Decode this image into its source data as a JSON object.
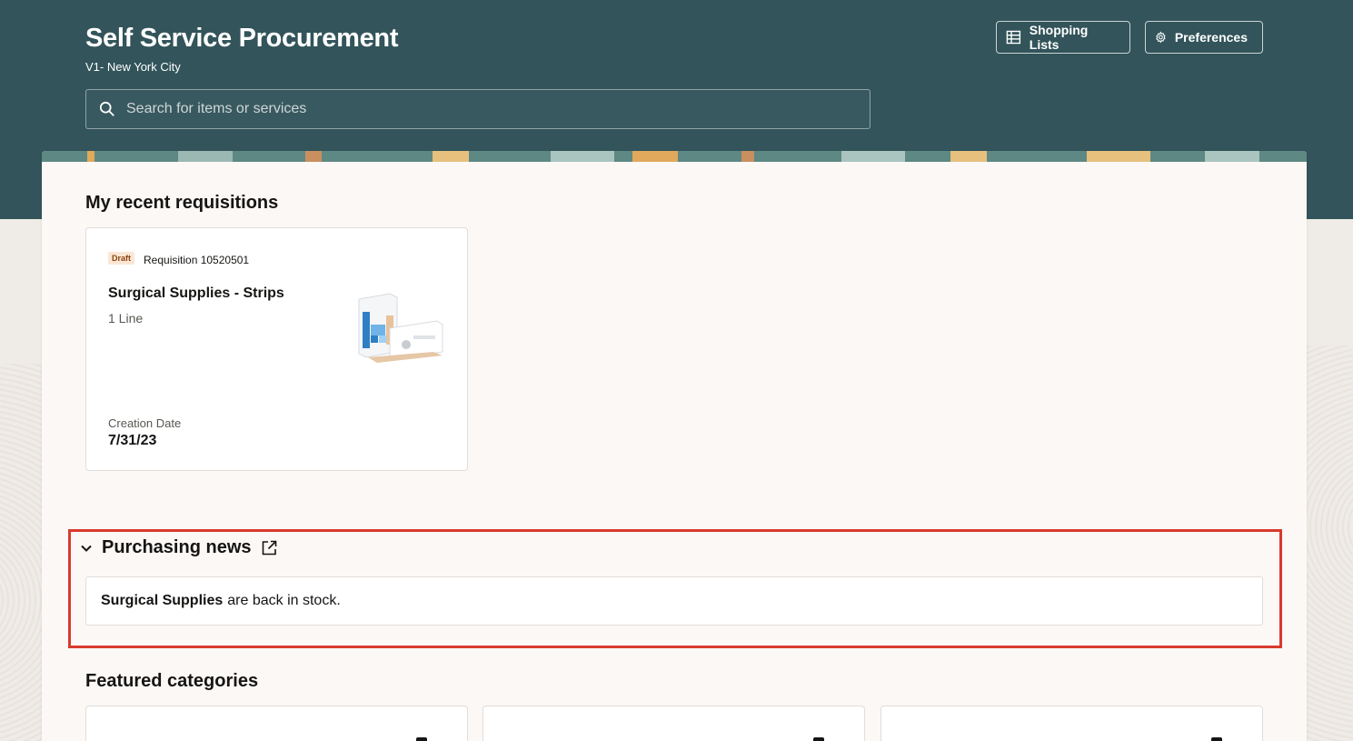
{
  "header": {
    "title": "Self Service Procurement",
    "location": "V1- New York City",
    "search_placeholder": "Search for items or services",
    "search_icon": "search-icon",
    "buttons": [
      {
        "label": "Shopping Lists",
        "icon": "table-icon"
      },
      {
        "label": "Preferences",
        "icon": "gear-icon"
      }
    ]
  },
  "recent": {
    "title": "My recent requisitions",
    "cards": [
      {
        "status": "Draft",
        "requisition": "Requisition 10520501",
        "name": "Surgical Supplies - Strips",
        "lines": "1 Line",
        "date_label": "Creation Date",
        "date": "7/31/23",
        "image": "surgical-strips-product-image"
      }
    ]
  },
  "news": {
    "title": "Purchasing news",
    "item_bold": "Surgical Supplies",
    "item_rest": "are back in stock."
  },
  "featured": {
    "title": "Featured categories",
    "count": 3
  },
  "colors": {
    "header_bg": "#32545a",
    "highlight_border": "#d93a2e",
    "draft_badge_bg": "#fbe7d5"
  }
}
